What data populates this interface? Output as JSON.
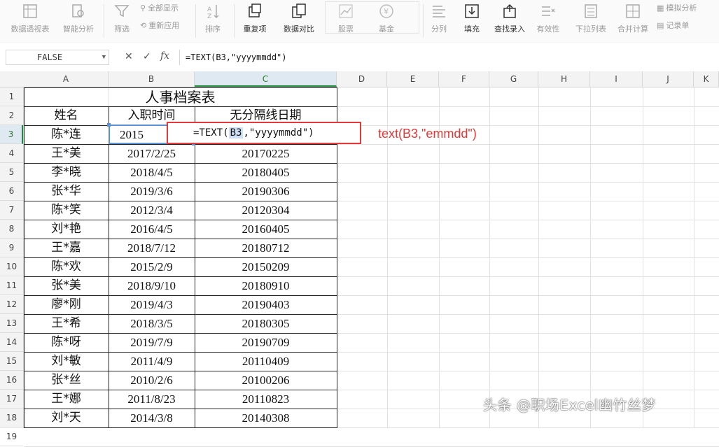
{
  "ribbon": {
    "pivot": "数据透视表",
    "smart_analysis": "智能分析",
    "filter": "筛选",
    "show_all": "全部显示",
    "reapply": "重新应用",
    "sort": "排序",
    "duplicates": "重复项",
    "data_compare": "数据对比",
    "stock": "股票",
    "fund": "基金",
    "split_column": "分列",
    "fill": "填充",
    "find_entry": "查找录入",
    "validity": "有效性",
    "dropdown_list": "下拉列表",
    "consolidate": "合并计算",
    "what_if": "模拟分析",
    "record_form": "记录单"
  },
  "formula_bar": {
    "name_box": "FALSE",
    "cancel": "✕",
    "confirm": "✓",
    "fx": "fx",
    "formula": "=TEXT(B3,\"yyyymmdd\")"
  },
  "columns": [
    "A",
    "B",
    "C",
    "D",
    "E",
    "F",
    "G",
    "H",
    "I",
    "J",
    "K"
  ],
  "rows": [
    "1",
    "2",
    "3",
    "4",
    "5",
    "6",
    "7",
    "8",
    "9",
    "10",
    "11",
    "12",
    "13",
    "14",
    "15",
    "16",
    "17",
    "18",
    "19"
  ],
  "sheet": {
    "title": "人事档案表",
    "headers": [
      "姓名",
      "入职时间",
      "无分隔线日期"
    ],
    "records": [
      {
        "name": "陈*连",
        "date": "2015",
        "compact": ""
      },
      {
        "name": "王*美",
        "date": "2017/2/25",
        "compact": "20170225"
      },
      {
        "name": "李*晓",
        "date": "2018/4/5",
        "compact": "20180405"
      },
      {
        "name": "张*华",
        "date": "2019/3/6",
        "compact": "20190306"
      },
      {
        "name": "陈*笑",
        "date": "2012/3/4",
        "compact": "20120304"
      },
      {
        "name": "刘*艳",
        "date": "2016/4/5",
        "compact": "20160405"
      },
      {
        "name": "王*嘉",
        "date": "2018/7/12",
        "compact": "20180712"
      },
      {
        "name": "陈*欢",
        "date": "2015/2/9",
        "compact": "20150209"
      },
      {
        "name": "张*美",
        "date": "2018/9/10",
        "compact": "20180910"
      },
      {
        "name": "廖*刚",
        "date": "2019/4/3",
        "compact": "20190403"
      },
      {
        "name": "王*希",
        "date": "2018/3/5",
        "compact": "20180305"
      },
      {
        "name": "陈*呀",
        "date": "2019/7/9",
        "compact": "20190709"
      },
      {
        "name": "刘*敏",
        "date": "2011/4/9",
        "compact": "20110409"
      },
      {
        "name": "张*丝",
        "date": "2010/2/6",
        "compact": "20100206"
      },
      {
        "name": "王*娜",
        "date": "2011/8/23",
        "compact": "20110823"
      },
      {
        "name": "刘*天",
        "date": "2014/3/8",
        "compact": "20140308"
      }
    ]
  },
  "editing": {
    "prefix": "=TEXT(",
    "ref": "B3",
    "suffix": ",\"yyyymmdd\")"
  },
  "annotation": "text(B3,\"emmdd\")",
  "watermark": "头条 @职场Excel幽竹丝梦",
  "colors": {
    "accent": "#1f8a3b",
    "highlight": "#e23a3a",
    "selection": "#5b8fd6"
  }
}
